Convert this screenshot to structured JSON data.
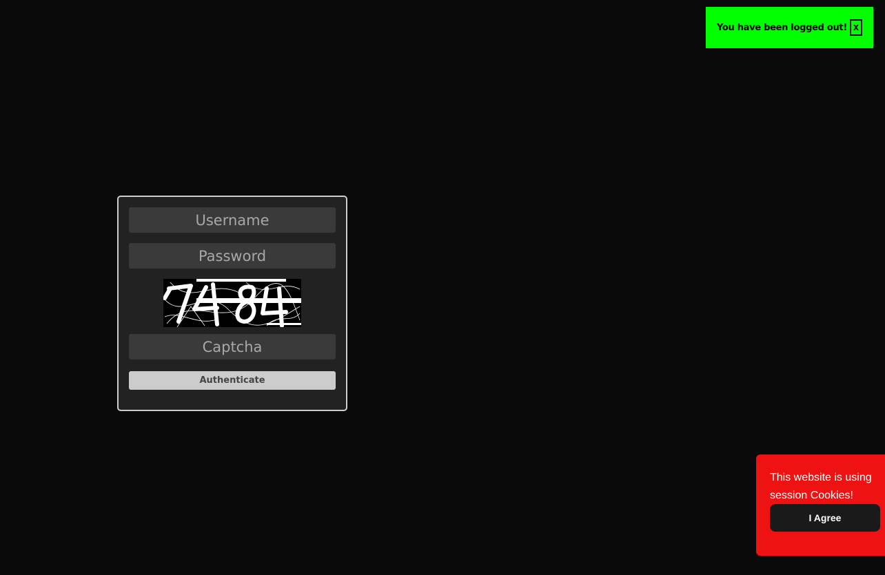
{
  "notification": {
    "message": "You have been logged out!",
    "close_label": "x",
    "color": "#00ff00"
  },
  "login": {
    "username_placeholder": "Username",
    "password_placeholder": "Password",
    "captcha_placeholder": "Captcha",
    "captcha_image_text": "7484",
    "authenticate_label": "Authenticate"
  },
  "cookie_banner": {
    "message": "This website is using session Cookies!",
    "agree_label": "I Agree",
    "color": "#ee1212"
  }
}
